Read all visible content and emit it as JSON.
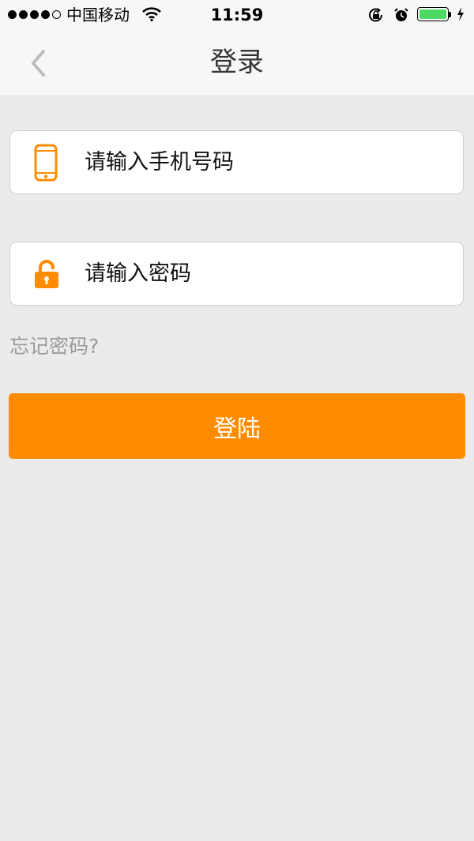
{
  "status_bar": {
    "carrier": "中国移动",
    "time": "11:59",
    "battery_level": 1.0,
    "battery_color": "#4cd964"
  },
  "nav": {
    "title": "登录",
    "back_icon": "chevron-left-icon"
  },
  "form": {
    "phone": {
      "icon": "phone-icon",
      "placeholder": "请输入手机号码",
      "value": ""
    },
    "password": {
      "icon": "lock-icon",
      "placeholder": "请输入密码",
      "value": ""
    },
    "forgot_label": "忘记密码?",
    "submit_label": "登陆"
  },
  "colors": {
    "accent": "#ff8c00",
    "background": "#ebebeb",
    "nav_background": "#f7f7f7",
    "muted_text": "#9a9a9a"
  }
}
